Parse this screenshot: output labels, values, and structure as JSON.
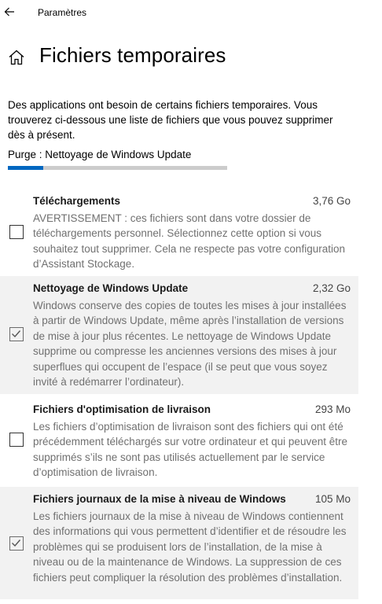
{
  "window": {
    "title": "Paramètres"
  },
  "header": {
    "title": "Fichiers temporaires"
  },
  "description": "Des applications ont besoin de certains fichiers temporaires. Vous trouverez ci-dessous une liste de fichiers que vous pouvez supprimer dès à présent.",
  "purge": {
    "label": "Purge : Nettoyage de Windows Update",
    "progress": 0.16
  },
  "colors": {
    "accent": "#0067c0",
    "selected_background": "#f2f2f2"
  },
  "icons": {
    "back": "arrow-left-icon",
    "home": "home-icon",
    "check": "checkmark-icon"
  },
  "items": [
    {
      "name": "Téléchargements",
      "size": "3,76 Go",
      "checked": false,
      "description": "AVERTISSEMENT : ces fichiers sont dans votre dossier de téléchargements personnel. Sélectionnez cette option si vous souhaitez tout supprimer. Cela ne respecte pas votre configuration d’Assistant Stockage."
    },
    {
      "name": "Nettoyage de Windows Update",
      "size": "2,32 Go",
      "checked": true,
      "description": "Windows conserve des copies de toutes les mises à jour installées à partir de Windows Update, même après l’installation de versions de mise à jour plus récentes. Le nettoyage de Windows Update supprime ou compresse les anciennes versions des mises à jour superflues qui occupent de l’espace (il se peut que vous soyez invité à redémarrer l’ordinateur)."
    },
    {
      "name": "Fichiers d'optimisation de livraison",
      "size": "293 Mo",
      "checked": false,
      "description": "Les fichiers d’optimisation de livraison sont des fichiers qui ont été précédemment téléchargés sur votre ordinateur et qui peuvent être supprimés s’ils ne sont pas utilisés actuellement par le service d’optimisation de livraison."
    },
    {
      "name": "Fichiers journaux de la mise à niveau de Windows",
      "size": "105 Mo",
      "checked": true,
      "description": "Les fichiers journaux de la mise à niveau de Windows contiennent des informations qui vous permettent d’identifier et de résoudre les problèmes qui se produisent lors de l’installation, de la mise à niveau ou de la maintenance de Windows. La suppression de ces fichiers peut compliquer la résolution des problèmes d’installation."
    }
  ]
}
